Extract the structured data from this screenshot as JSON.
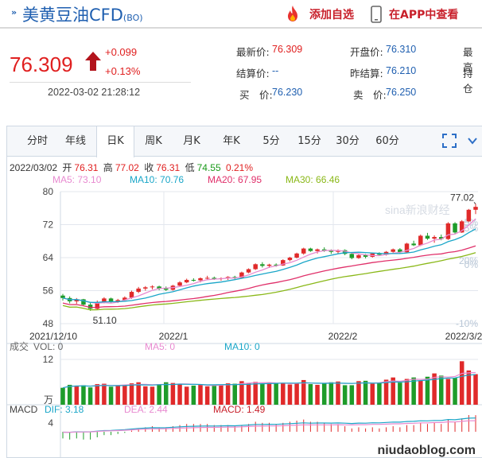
{
  "header": {
    "title": "美黄豆油CFD",
    "code": "(BO)",
    "add_fav": "添加自选",
    "app_view": "在APP中查看"
  },
  "quote": {
    "price": "76.309",
    "change": "+0.099",
    "change_pct": "+0.13%",
    "timestamp": "2022-03-02 21:28:12",
    "fields": [
      {
        "label": "最新价:",
        "value": "76.309",
        "color": "red"
      },
      {
        "label": "开盘价:",
        "value": "76.310",
        "color": "blue"
      },
      {
        "label": "最高",
        "value": "",
        "color": "blue"
      },
      {
        "label": "结算价:",
        "value": "--",
        "color": "blue"
      },
      {
        "label": "昨结算:",
        "value": "76.210",
        "color": "blue"
      },
      {
        "label": "持仓",
        "value": "",
        "color": "blue"
      },
      {
        "label": "买　价:",
        "value": "76.230",
        "color": "blue"
      },
      {
        "label": "卖　价:",
        "value": "76.250",
        "color": "blue"
      }
    ]
  },
  "tabs": [
    "分时",
    "年线",
    "日K",
    "周K",
    "月K",
    "年K",
    "5分",
    "15分",
    "30分",
    "60分"
  ],
  "active_tab": "日K",
  "kline_info": {
    "date": "2022/03/02",
    "open_label": "开",
    "open": "76.31",
    "high_label": "高",
    "high": "77.02",
    "close_label": "收",
    "close": "76.31",
    "low_label": "低",
    "low": "74.55",
    "pct": "0.21%"
  },
  "ma_legend": [
    {
      "label": "MA5: 73.10",
      "color": "#e88ad0"
    },
    {
      "label": "MA10: 70.76",
      "color": "#1aa6c8"
    },
    {
      "label": "MA20: 67.95",
      "color": "#e0306a"
    },
    {
      "label": "MA30: 66.46",
      "color": "#8ab818"
    }
  ],
  "vol_legend": [
    {
      "label": "成交",
      "color": "#666"
    },
    {
      "label": "VOL: 0",
      "color": "#666"
    },
    {
      "label": "MA5: 0",
      "color": "#e88ad0"
    },
    {
      "label": "MA10: 0",
      "color": "#1aa6c8"
    }
  ],
  "macd_legend": [
    {
      "label": "MACD",
      "color": "#444"
    },
    {
      "label": "DIF: 3.18",
      "color": "#1aa6c8"
    },
    {
      "label": "DEA: 2.44",
      "color": "#e88ad0"
    },
    {
      "label": "MACD: 1.49",
      "color": "#c8202b"
    }
  ],
  "watermark": "sina新浪财经",
  "site_watermark": "niudaoblog.com",
  "chart_data": {
    "type": "candlestick",
    "price_axis": {
      "ticks": [
        "80",
        "72",
        "64",
        "56",
        "48"
      ],
      "range": [
        48,
        80
      ]
    },
    "pct_axis": {
      "ticks": [
        "5%",
        "0%",
        "-10%"
      ]
    },
    "pct_extra_ticks": [
      "20%",
      "15%"
    ],
    "date_labels": [
      "2021/12/10",
      "2022/1",
      "2022/2",
      "2022/3/2"
    ],
    "max_label": "77.02",
    "min_label": "51.10",
    "vol_axis": {
      "ticks": [
        "12",
        "万"
      ]
    },
    "macd_axis": {
      "ticks": [
        "4"
      ]
    },
    "candles": [
      [
        54.8,
        55.2,
        53.6,
        54.2
      ],
      [
        54.2,
        54.6,
        52.9,
        53.4
      ],
      [
        53.4,
        54.2,
        52.8,
        53.9
      ],
      [
        53.9,
        54.0,
        52.3,
        52.6
      ],
      [
        52.6,
        53.0,
        51.1,
        51.6
      ],
      [
        51.6,
        53.6,
        51.4,
        53.2
      ],
      [
        53.2,
        54.4,
        52.9,
        54.1
      ],
      [
        54.1,
        54.3,
        53.0,
        53.4
      ],
      [
        53.4,
        54.0,
        53.0,
        53.7
      ],
      [
        53.7,
        54.6,
        53.5,
        54.3
      ],
      [
        54.3,
        56.0,
        54.0,
        55.7
      ],
      [
        55.7,
        56.9,
        55.4,
        56.5
      ],
      [
        56.5,
        57.1,
        56.0,
        56.8
      ],
      [
        56.8,
        57.3,
        56.3,
        57.0
      ],
      [
        57.0,
        57.2,
        56.1,
        56.5
      ],
      [
        56.5,
        57.0,
        55.9,
        56.2
      ],
      [
        56.2,
        57.4,
        56.0,
        57.2
      ],
      [
        57.2,
        58.3,
        57.0,
        58.0
      ],
      [
        58.0,
        58.9,
        57.8,
        58.6
      ],
      [
        58.6,
        59.0,
        58.2,
        58.5
      ],
      [
        58.5,
        59.2,
        58.0,
        59.0
      ],
      [
        59.0,
        59.6,
        58.7,
        59.1
      ],
      [
        59.1,
        59.4,
        58.6,
        58.8
      ],
      [
        58.8,
        59.2,
        58.4,
        59.0
      ],
      [
        59.0,
        59.5,
        58.6,
        59.3
      ],
      [
        59.3,
        59.6,
        58.8,
        59.1
      ],
      [
        59.1,
        60.6,
        59.0,
        60.4
      ],
      [
        60.4,
        61.4,
        60.2,
        61.2
      ],
      [
        61.2,
        62.6,
        61.0,
        62.4
      ],
      [
        62.4,
        62.9,
        61.6,
        62.0
      ],
      [
        62.0,
        62.5,
        61.5,
        62.3
      ],
      [
        62.3,
        62.6,
        61.8,
        62.1
      ],
      [
        62.1,
        63.6,
        62.0,
        63.4
      ],
      [
        63.4,
        64.2,
        63.1,
        64.0
      ],
      [
        64.0,
        65.2,
        63.8,
        65.0
      ],
      [
        65.0,
        66.4,
        64.7,
        66.2
      ],
      [
        66.2,
        66.4,
        65.4,
        65.6
      ],
      [
        65.6,
        66.2,
        65.0,
        66.0
      ],
      [
        66.0,
        66.5,
        65.4,
        65.7
      ],
      [
        65.7,
        66.0,
        64.9,
        65.4
      ],
      [
        65.4,
        66.0,
        65.0,
        65.8
      ],
      [
        65.8,
        66.0,
        64.6,
        64.9
      ],
      [
        64.9,
        65.3,
        63.6,
        63.9
      ],
      [
        63.9,
        64.8,
        63.7,
        64.6
      ],
      [
        64.6,
        64.9,
        63.8,
        64.2
      ],
      [
        64.2,
        65.2,
        64.0,
        65.0
      ],
      [
        65.0,
        65.3,
        64.4,
        64.7
      ],
      [
        64.7,
        65.6,
        64.5,
        65.4
      ],
      [
        65.4,
        66.2,
        65.2,
        66.0
      ],
      [
        66.0,
        66.3,
        65.0,
        65.3
      ],
      [
        65.3,
        67.6,
        65.2,
        67.4
      ],
      [
        67.4,
        68.1,
        66.8,
        67.0
      ],
      [
        67.0,
        69.6,
        66.8,
        69.3
      ],
      [
        69.3,
        70.0,
        68.3,
        68.6
      ],
      [
        68.6,
        69.4,
        67.6,
        69.0
      ],
      [
        69.0,
        69.6,
        68.2,
        68.5
      ],
      [
        68.5,
        72.6,
        68.3,
        72.3
      ],
      [
        72.3,
        72.6,
        69.8,
        70.1
      ],
      [
        70.1,
        73.1,
        70.0,
        72.8
      ],
      [
        72.8,
        75.8,
        72.6,
        75.6
      ],
      [
        75.6,
        77.02,
        74.55,
        76.31
      ]
    ],
    "volumes": [
      4.6,
      5.4,
      5.2,
      5.3,
      4.7,
      5.6,
      5.7,
      4.9,
      5.3,
      5.4,
      5.8,
      6.1,
      5.0,
      4.9,
      5.6,
      6.1,
      5.9,
      5.7,
      4.9,
      5.2,
      5.6,
      5.0,
      5.3,
      5.4,
      5.8,
      5.7,
      6.4,
      5.9,
      6.2,
      5.6,
      6.0,
      5.8,
      5.8,
      5.5,
      5.8,
      6.7,
      5.6,
      5.4,
      5.8,
      6.1,
      6.3,
      5.3,
      5.3,
      6.4,
      6.5,
      5.7,
      5.9,
      6.8,
      7.4,
      6.0,
      7.0,
      7.4,
      6.6,
      7.6,
      8.5,
      7.9,
      7.0,
      7.3,
      11.8,
      9.3,
      8.3
    ],
    "macd": [
      -0.6,
      -0.7,
      -0.6,
      -0.7,
      -0.7,
      -0.5,
      -0.3,
      -0.3,
      -0.2,
      -0.1,
      0.1,
      0.3,
      0.4,
      0.5,
      0.4,
      0.4,
      0.5,
      0.6,
      0.7,
      0.7,
      0.7,
      0.7,
      0.6,
      0.6,
      0.6,
      0.5,
      0.6,
      0.7,
      0.9,
      0.8,
      0.8,
      0.7,
      0.8,
      0.9,
      1.0,
      1.1,
      0.9,
      0.9,
      0.8,
      0.7,
      0.7,
      0.5,
      0.3,
      0.4,
      0.3,
      0.4,
      0.3,
      0.4,
      0.5,
      0.4,
      0.6,
      0.6,
      0.8,
      0.7,
      0.8,
      0.7,
      1.1,
      0.9,
      1.2,
      1.5,
      1.49
    ]
  }
}
